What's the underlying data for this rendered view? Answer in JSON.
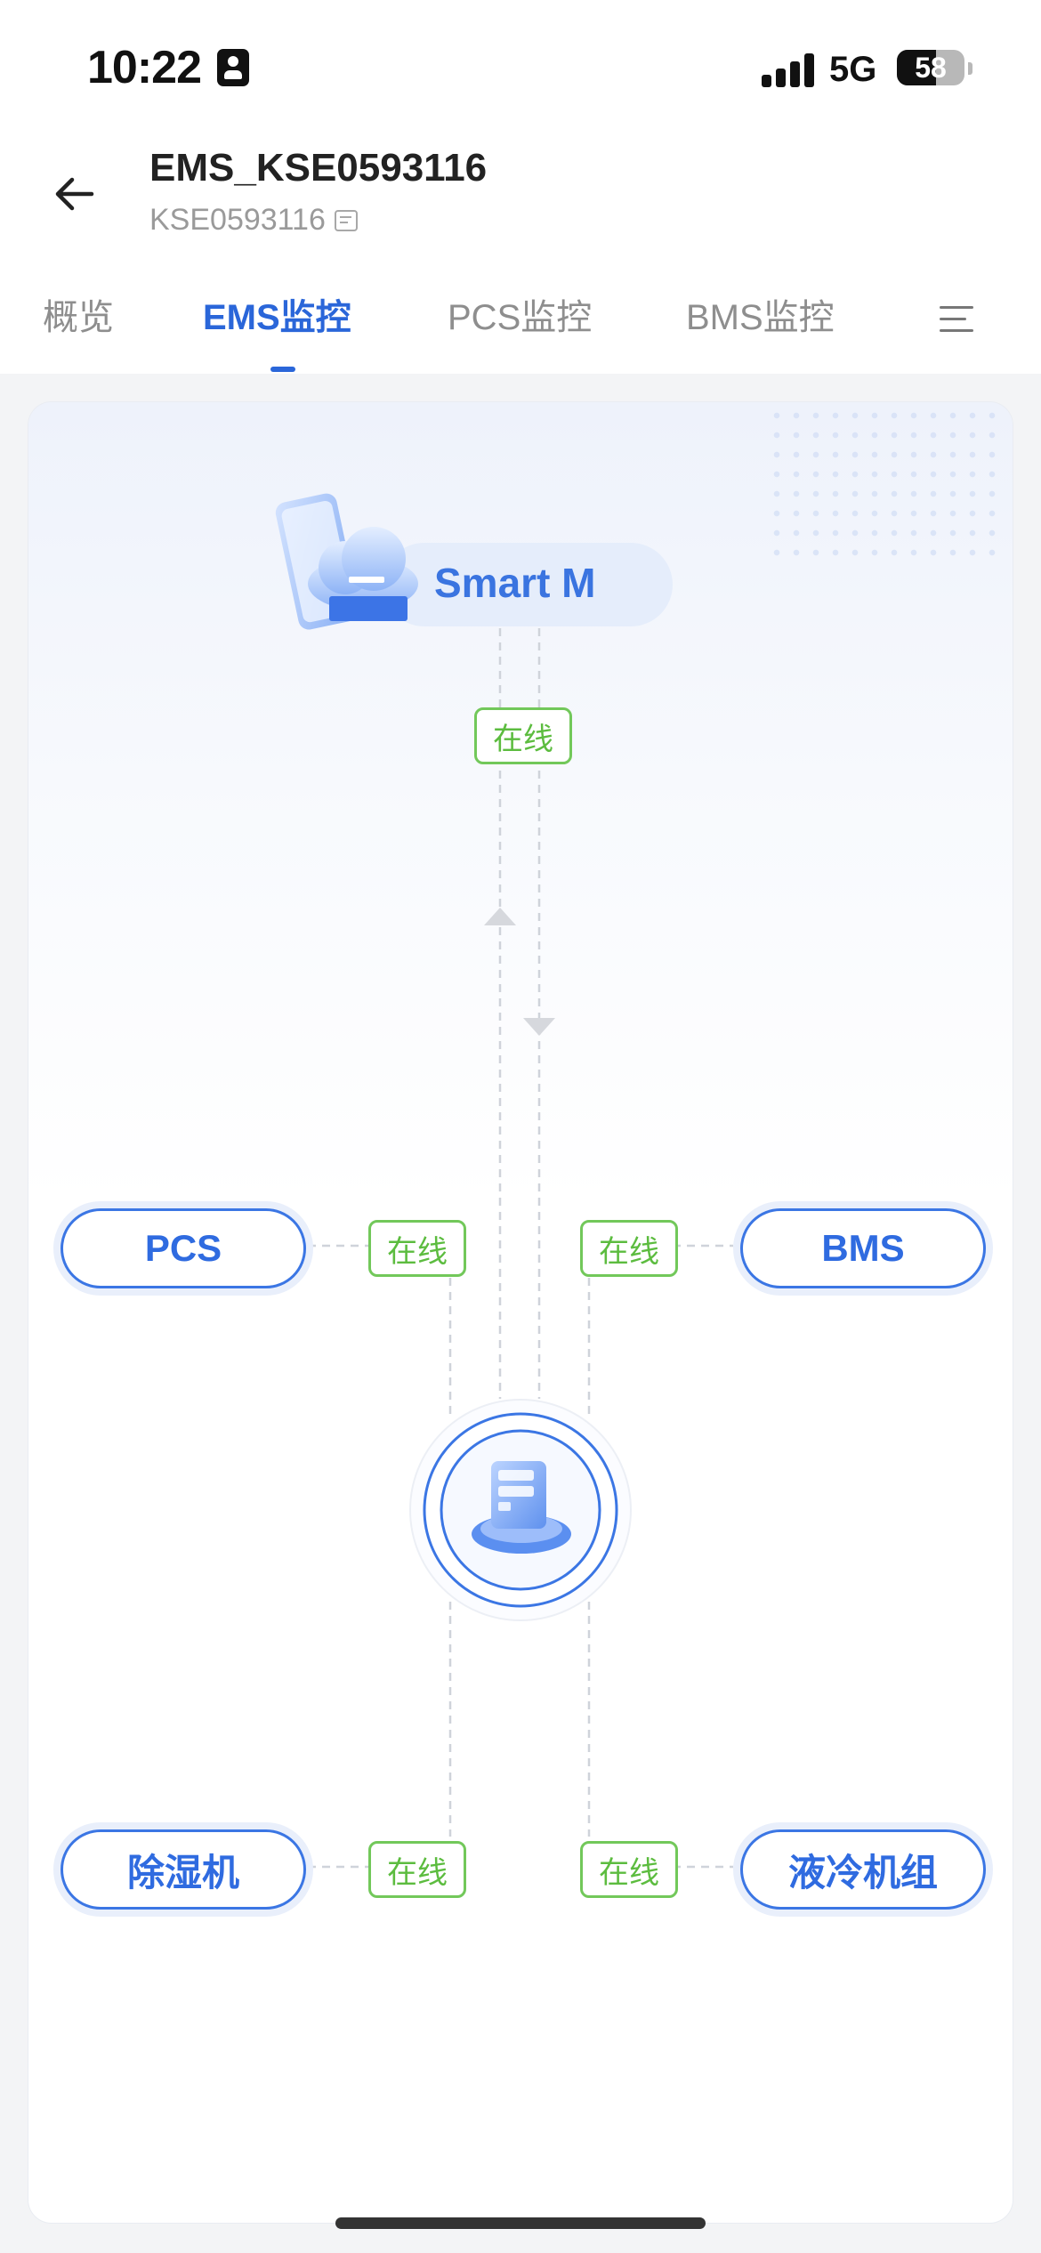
{
  "status_bar": {
    "time": "10:22",
    "network": "5G",
    "battery": "58",
    "battery_level": 0.58
  },
  "header": {
    "back_icon": "arrow-left-icon",
    "title": "EMS_KSE0593116",
    "subtitle": "KSE0593116",
    "subtitle_icon": "note-icon"
  },
  "tabs": [
    {
      "label": "概览",
      "active": false
    },
    {
      "label": "EMS监控",
      "active": true
    },
    {
      "label": "PCS监控",
      "active": false
    },
    {
      "label": "BMS监控",
      "active": false
    }
  ],
  "menu_icon": "menu-icon",
  "diagram": {
    "cloud": {
      "label": "Smart M",
      "status": "在线",
      "icon": "cloud-phone-icon"
    },
    "center_icon": "server-icon",
    "nodes": {
      "pcs": {
        "label": "PCS",
        "status": "在线"
      },
      "bms": {
        "label": "BMS",
        "status": "在线"
      },
      "dehumidifier": {
        "label": "除湿机",
        "status": "在线"
      },
      "liquid_cooling": {
        "label": "液冷机组",
        "status": "在线"
      }
    },
    "colors": {
      "accent": "#2f6be0",
      "online": "#5cbc3f",
      "line": "#cfd3da"
    }
  }
}
